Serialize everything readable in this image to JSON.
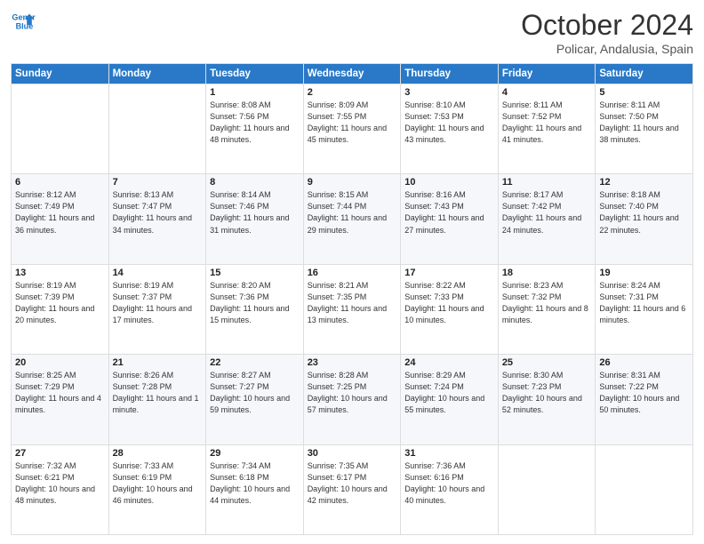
{
  "header": {
    "logo_line1": "General",
    "logo_line2": "Blue",
    "title": "October 2024",
    "subtitle": "Policar, Andalusia, Spain"
  },
  "weekdays": [
    "Sunday",
    "Monday",
    "Tuesday",
    "Wednesday",
    "Thursday",
    "Friday",
    "Saturday"
  ],
  "weeks": [
    [
      {
        "day": "",
        "info": ""
      },
      {
        "day": "",
        "info": ""
      },
      {
        "day": "1",
        "info": "Sunrise: 8:08 AM\nSunset: 7:56 PM\nDaylight: 11 hours and 48 minutes."
      },
      {
        "day": "2",
        "info": "Sunrise: 8:09 AM\nSunset: 7:55 PM\nDaylight: 11 hours and 45 minutes."
      },
      {
        "day": "3",
        "info": "Sunrise: 8:10 AM\nSunset: 7:53 PM\nDaylight: 11 hours and 43 minutes."
      },
      {
        "day": "4",
        "info": "Sunrise: 8:11 AM\nSunset: 7:52 PM\nDaylight: 11 hours and 41 minutes."
      },
      {
        "day": "5",
        "info": "Sunrise: 8:11 AM\nSunset: 7:50 PM\nDaylight: 11 hours and 38 minutes."
      }
    ],
    [
      {
        "day": "6",
        "info": "Sunrise: 8:12 AM\nSunset: 7:49 PM\nDaylight: 11 hours and 36 minutes."
      },
      {
        "day": "7",
        "info": "Sunrise: 8:13 AM\nSunset: 7:47 PM\nDaylight: 11 hours and 34 minutes."
      },
      {
        "day": "8",
        "info": "Sunrise: 8:14 AM\nSunset: 7:46 PM\nDaylight: 11 hours and 31 minutes."
      },
      {
        "day": "9",
        "info": "Sunrise: 8:15 AM\nSunset: 7:44 PM\nDaylight: 11 hours and 29 minutes."
      },
      {
        "day": "10",
        "info": "Sunrise: 8:16 AM\nSunset: 7:43 PM\nDaylight: 11 hours and 27 minutes."
      },
      {
        "day": "11",
        "info": "Sunrise: 8:17 AM\nSunset: 7:42 PM\nDaylight: 11 hours and 24 minutes."
      },
      {
        "day": "12",
        "info": "Sunrise: 8:18 AM\nSunset: 7:40 PM\nDaylight: 11 hours and 22 minutes."
      }
    ],
    [
      {
        "day": "13",
        "info": "Sunrise: 8:19 AM\nSunset: 7:39 PM\nDaylight: 11 hours and 20 minutes."
      },
      {
        "day": "14",
        "info": "Sunrise: 8:19 AM\nSunset: 7:37 PM\nDaylight: 11 hours and 17 minutes."
      },
      {
        "day": "15",
        "info": "Sunrise: 8:20 AM\nSunset: 7:36 PM\nDaylight: 11 hours and 15 minutes."
      },
      {
        "day": "16",
        "info": "Sunrise: 8:21 AM\nSunset: 7:35 PM\nDaylight: 11 hours and 13 minutes."
      },
      {
        "day": "17",
        "info": "Sunrise: 8:22 AM\nSunset: 7:33 PM\nDaylight: 11 hours and 10 minutes."
      },
      {
        "day": "18",
        "info": "Sunrise: 8:23 AM\nSunset: 7:32 PM\nDaylight: 11 hours and 8 minutes."
      },
      {
        "day": "19",
        "info": "Sunrise: 8:24 AM\nSunset: 7:31 PM\nDaylight: 11 hours and 6 minutes."
      }
    ],
    [
      {
        "day": "20",
        "info": "Sunrise: 8:25 AM\nSunset: 7:29 PM\nDaylight: 11 hours and 4 minutes."
      },
      {
        "day": "21",
        "info": "Sunrise: 8:26 AM\nSunset: 7:28 PM\nDaylight: 11 hours and 1 minute."
      },
      {
        "day": "22",
        "info": "Sunrise: 8:27 AM\nSunset: 7:27 PM\nDaylight: 10 hours and 59 minutes."
      },
      {
        "day": "23",
        "info": "Sunrise: 8:28 AM\nSunset: 7:25 PM\nDaylight: 10 hours and 57 minutes."
      },
      {
        "day": "24",
        "info": "Sunrise: 8:29 AM\nSunset: 7:24 PM\nDaylight: 10 hours and 55 minutes."
      },
      {
        "day": "25",
        "info": "Sunrise: 8:30 AM\nSunset: 7:23 PM\nDaylight: 10 hours and 52 minutes."
      },
      {
        "day": "26",
        "info": "Sunrise: 8:31 AM\nSunset: 7:22 PM\nDaylight: 10 hours and 50 minutes."
      }
    ],
    [
      {
        "day": "27",
        "info": "Sunrise: 7:32 AM\nSunset: 6:21 PM\nDaylight: 10 hours and 48 minutes."
      },
      {
        "day": "28",
        "info": "Sunrise: 7:33 AM\nSunset: 6:19 PM\nDaylight: 10 hours and 46 minutes."
      },
      {
        "day": "29",
        "info": "Sunrise: 7:34 AM\nSunset: 6:18 PM\nDaylight: 10 hours and 44 minutes."
      },
      {
        "day": "30",
        "info": "Sunrise: 7:35 AM\nSunset: 6:17 PM\nDaylight: 10 hours and 42 minutes."
      },
      {
        "day": "31",
        "info": "Sunrise: 7:36 AM\nSunset: 6:16 PM\nDaylight: 10 hours and 40 minutes."
      },
      {
        "day": "",
        "info": ""
      },
      {
        "day": "",
        "info": ""
      }
    ]
  ]
}
